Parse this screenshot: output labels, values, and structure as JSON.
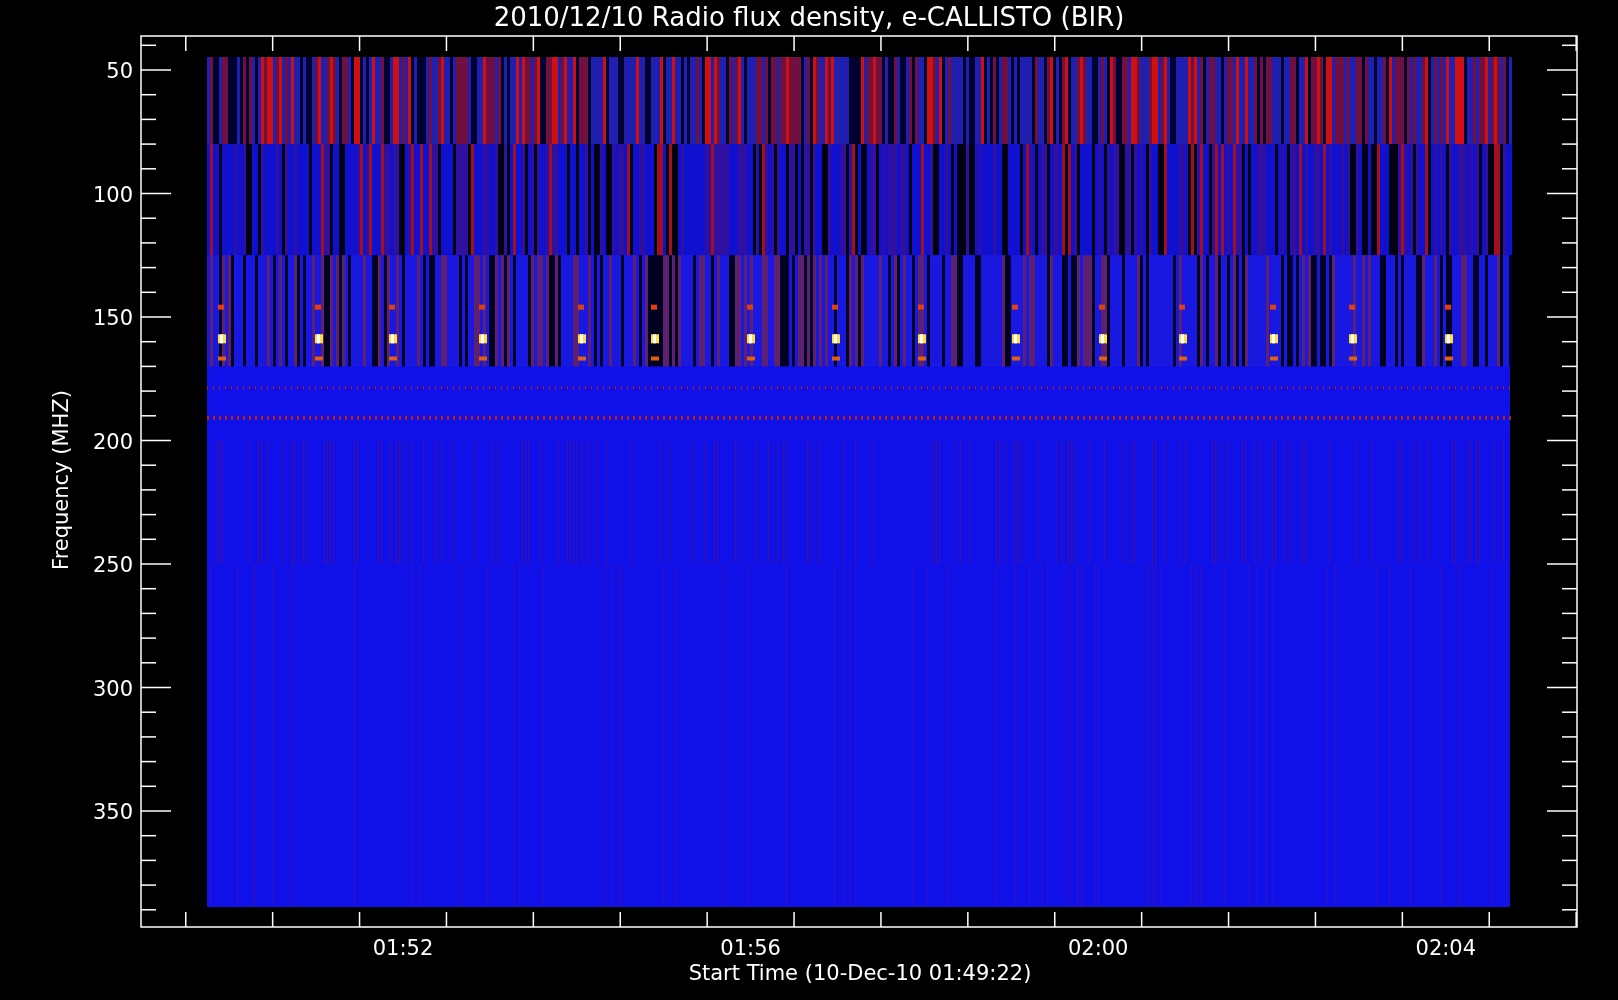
{
  "title": "2010/12/10  Radio flux density, e-CALLISTO (BIR)",
  "y_axis": {
    "label": "Frequency (MHZ)",
    "ticks": [
      "50",
      "100",
      "150",
      "200",
      "250",
      "300",
      "350"
    ]
  },
  "x_axis": {
    "label": "Start Time (10-Dec-10 01:49:22)",
    "ticks": [
      "01:52",
      "01:56",
      "02:00",
      "02:04"
    ]
  }
}
